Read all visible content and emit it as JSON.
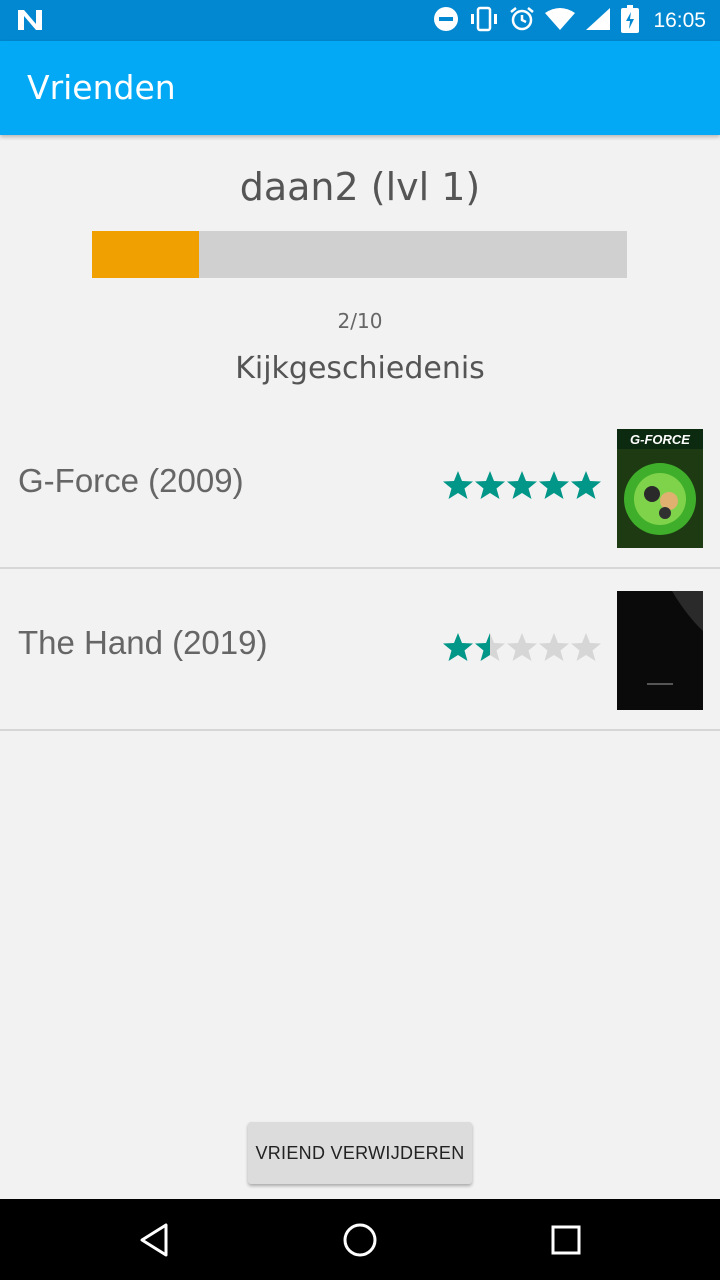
{
  "status_bar": {
    "time": "16:05",
    "icons": [
      "n-logo-icon",
      "do-not-disturb-icon",
      "vibrate-icon",
      "alarm-icon",
      "wifi-icon",
      "signal-icon",
      "battery-charging-icon"
    ]
  },
  "app_bar": {
    "title": "Vrienden"
  },
  "profile": {
    "username": "daan2 (lvl 1)",
    "progress_text": "2/10",
    "progress_value": 0.2
  },
  "history": {
    "title": "Kijkgeschiedenis",
    "items": [
      {
        "title": "G-Force (2009)",
        "rating": 5,
        "max_rating": 5,
        "poster_text": "G-FORCE"
      },
      {
        "title": "The Hand (2019)",
        "rating": 1.5,
        "max_rating": 5,
        "poster_text": ""
      }
    ]
  },
  "actions": {
    "remove_friend_label": "VRIEND VERWIJDEREN"
  },
  "nav": {
    "icons": [
      "back-icon",
      "home-icon",
      "recents-icon"
    ]
  },
  "colors": {
    "accent": "#03a9f4",
    "status_bar": "#0288d1",
    "progress": "#f0a000",
    "star": "#009688",
    "star_empty": "#d6d6d6"
  }
}
